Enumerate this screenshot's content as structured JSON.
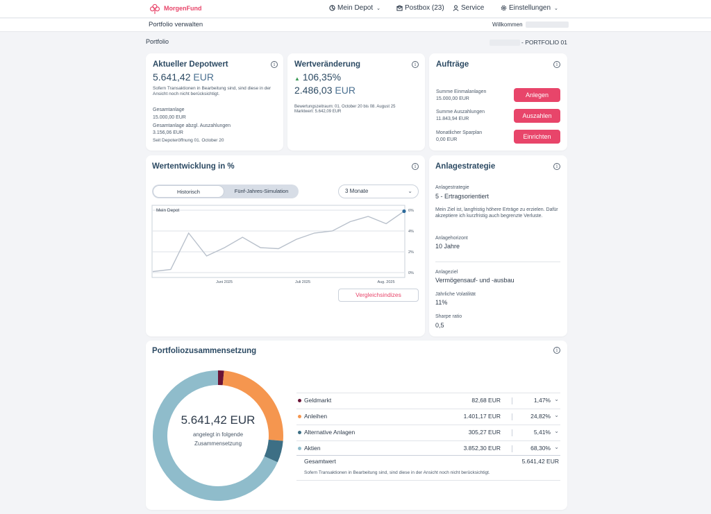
{
  "brand": {
    "name": "MorgenFund",
    "color": "#e8456a"
  },
  "nav": {
    "depot": "Mein Depot",
    "postbox": "Postbox (23)",
    "service": "Service",
    "settings": "Einstellungen"
  },
  "subbar": {
    "left": "Portfolio verwalten",
    "welcome": "Willkommen"
  },
  "breadcrumb": {
    "left": "Portfolio",
    "right": "- PORTFOLIO 01"
  },
  "depotwert": {
    "title": "Aktueller Depotwert",
    "amount": "5.641,42",
    "currency": "EUR",
    "note": "Sofern Transaktionen in Bearbeitung sind, sind diese in der Ansicht noch nicht berücksichtigt.",
    "gesamtanlage_label": "Gesamtanlage",
    "gesamtanlage_value": "15.000,00 EUR",
    "abzgl_label": "Gesamtanlage abzgl. Auszahlungen",
    "abzgl_value": "3.156,06 EUR",
    "opened": "Seit Depoteröffnung 01. October 20"
  },
  "wertveraenderung": {
    "title": "Wertveränderung",
    "percent": "106,35%",
    "amount": "2.486,03",
    "currency": "EUR",
    "period": "Bewertungszeitraum: 01. October 20 bis 08. August 25",
    "marktwert": "Marktwert: 5.642,09 EUR"
  },
  "auftraege": {
    "title": "Aufträge",
    "rows": [
      {
        "label": "Summe Einmalanlagen",
        "value": "15.000,00 EUR",
        "button": "Anlegen"
      },
      {
        "label": "Summe Auszahlungen",
        "value": "11.843,94 EUR",
        "button": "Auszahlen"
      },
      {
        "label": "Monatlicher Sparplan",
        "value": "0,00 EUR",
        "button": "Einrichten"
      }
    ]
  },
  "wertentwicklung": {
    "title": "Wertentwicklung in %",
    "tab_historisch": "Historisch",
    "tab_simulation": "Fünf-Jahres-Simulation",
    "range": "3 Monate",
    "compare_button": "Vergleichsindizes"
  },
  "chart_data": {
    "type": "line",
    "series": [
      {
        "name": "Mein Depot",
        "values": [
          0.1,
          0.3,
          3.8,
          1.6,
          2.4,
          3.4,
          2.4,
          2.3,
          3.2,
          3.8,
          4.0,
          4.9,
          5.4,
          4.7,
          5.9
        ]
      }
    ],
    "x_ticks": [
      "Juni 2025",
      "Juli 2025",
      "Aug. 2025"
    ],
    "y_ticks": [
      "0%",
      "2%",
      "4%",
      "6%"
    ],
    "ylim": [
      0,
      6
    ],
    "line_color": "#b8c0cb",
    "marker_color": "#2c6a9a"
  },
  "strategie": {
    "title": "Anlagestrategie",
    "strategy_label": "Anlagestrategie",
    "strategy_value": "5 - Ertragsorientiert",
    "description": "Mein Ziel ist, langfristig höhere Erträge zu erzielen. Dafür akzeptiere ich kurzfristig auch begrenzte Verluste.",
    "horizon_label": "Anlagehorizont",
    "horizon_value": "10 Jahre",
    "goal_label": "Anlageziel",
    "goal_value": "Vermögensauf- und -ausbau",
    "volatility_label": "Jährliche Volatilität",
    "volatility_value": "11%",
    "sharpe_label": "Sharpe ratio",
    "sharpe_value": "0,5"
  },
  "zusammensetzung": {
    "title": "Portfoliozusammensetzung",
    "center_amount": "5.641,42 EUR",
    "center_sub1": "angelegt in folgende",
    "center_sub2": "Zusammensetzung",
    "rows": [
      {
        "name": "Geldmarkt",
        "amount": "82,68 EUR",
        "percent": "1,47%",
        "share": 1.47,
        "color": "#6b1436"
      },
      {
        "name": "Anleihen",
        "amount": "1.401,17 EUR",
        "percent": "24,82%",
        "share": 24.82,
        "color": "#f5964f"
      },
      {
        "name": "Alternative Anlagen",
        "amount": "305,27 EUR",
        "percent": "5,41%",
        "share": 5.41,
        "color": "#3d6f85"
      },
      {
        "name": "Aktien",
        "amount": "3.852,30 EUR",
        "percent": "68,30%",
        "share": 68.3,
        "color": "#8fbccb"
      }
    ],
    "total_label": "Gesamtwert",
    "total_value": "5.641,42 EUR",
    "note": "Sofern Transaktionen in Bearbeitung sind, sind diese in der Ansicht noch nicht berücksichtigt."
  }
}
